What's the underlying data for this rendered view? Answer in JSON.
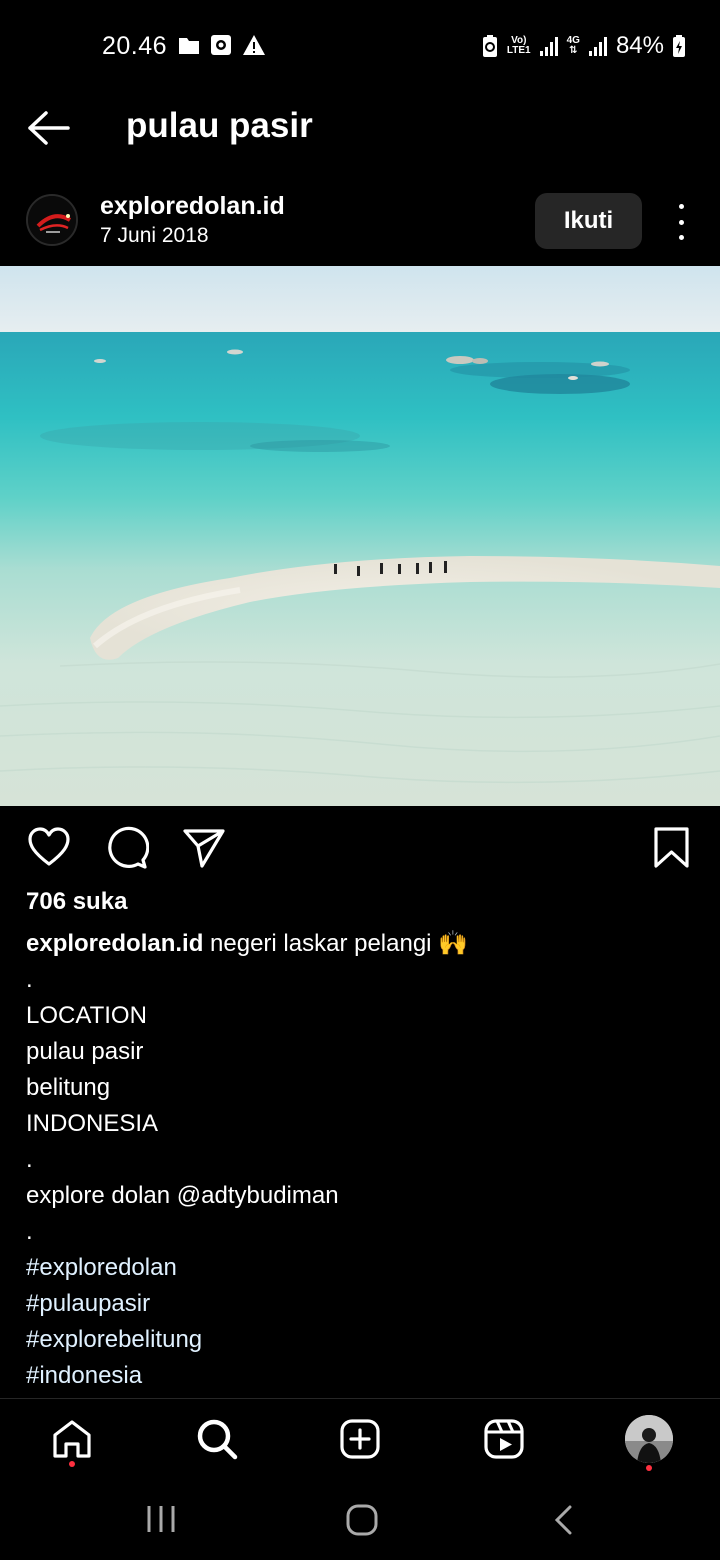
{
  "status_bar": {
    "time": "20.46",
    "volte_top": "Vo)",
    "volte_bottom": "LTE1",
    "net_type": "4G",
    "battery": "84%"
  },
  "header": {
    "title": "pulau pasir",
    "back_icon": "arrow-left-icon"
  },
  "post": {
    "username": "exploredolan.id",
    "date": "7 Juni 2018",
    "follow_label": "Ikuti",
    "likes": "706 suka",
    "caption_user": "exploredolan.id",
    "caption_first": " negeri laskar pelangi 🙌",
    "caption_lines": [
      ".",
      "LOCATION",
      "pulau pasir",
      "belitung",
      "INDONESIA",
      ".",
      "explore dolan @adtybudiman",
      "."
    ],
    "hashtags": [
      "#exploredolan",
      "#pulaupasir",
      "#explorebelitung",
      "#indonesia"
    ]
  },
  "actions": {
    "like": "heart-icon",
    "comment": "comment-icon",
    "share": "send-icon",
    "save": "bookmark-icon"
  },
  "bottom_nav": [
    "home-icon",
    "search-icon",
    "create-icon",
    "reels-icon",
    "profile-avatar"
  ],
  "colors": {
    "background": "#000000",
    "follow_button": "#262626",
    "notification_dot": "#ff3040",
    "sea_turquoise": "#33c2c4",
    "sand": "#e8e6dc"
  }
}
